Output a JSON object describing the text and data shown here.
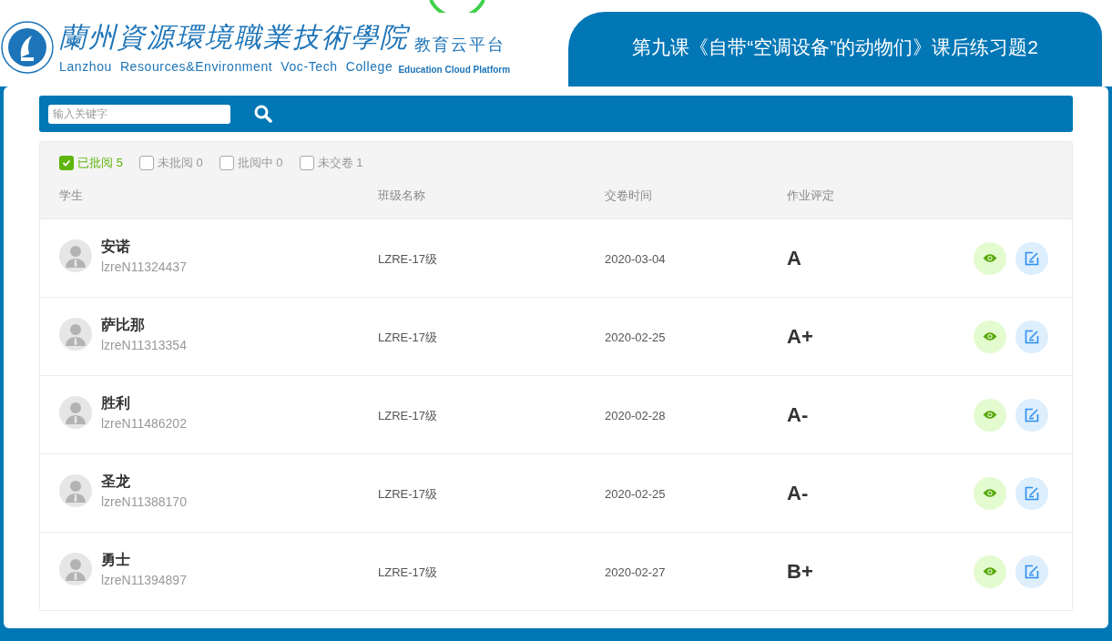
{
  "logo": {
    "title": "蘭州資源環境職業技術學院",
    "subtitle": "Lanzhou  Resources&Environment  Voc-Tech  College",
    "platform": "教育云平台",
    "platform_en": "Education Cloud Platform"
  },
  "page_title": "第九课《自带“空调设备”的动物们》课后练习题2",
  "search": {
    "placeholder": "输入关键字"
  },
  "filters": [
    {
      "label": "已批阅",
      "count": "5",
      "checked": true
    },
    {
      "label": "未批阅",
      "count": "0",
      "checked": false
    },
    {
      "label": "批阅中",
      "count": "0",
      "checked": false
    },
    {
      "label": "未交卷",
      "count": "1",
      "checked": false
    }
  ],
  "table": {
    "columns": [
      "学生",
      "班级名称",
      "交卷时间",
      "作业评定"
    ],
    "rows": [
      {
        "name": "安诺",
        "id": "lzreN11324437",
        "class": "LZRE-17级",
        "time": "2020-03-04",
        "grade": "A"
      },
      {
        "name": "萨比那",
        "id": "lzreN11313354",
        "class": "LZRE-17级",
        "time": "2020-02-25",
        "grade": "A+"
      },
      {
        "name": "胜利",
        "id": "lzreN11486202",
        "class": "LZRE-17级",
        "time": "2020-02-28",
        "grade": "A-"
      },
      {
        "name": "圣龙",
        "id": "lzreN11388170",
        "class": "LZRE-17级",
        "time": "2020-02-25",
        "grade": "A-"
      },
      {
        "name": "勇士",
        "id": "lzreN11394897",
        "class": "LZRE-17级",
        "time": "2020-02-27",
        "grade": "B+"
      }
    ]
  }
}
